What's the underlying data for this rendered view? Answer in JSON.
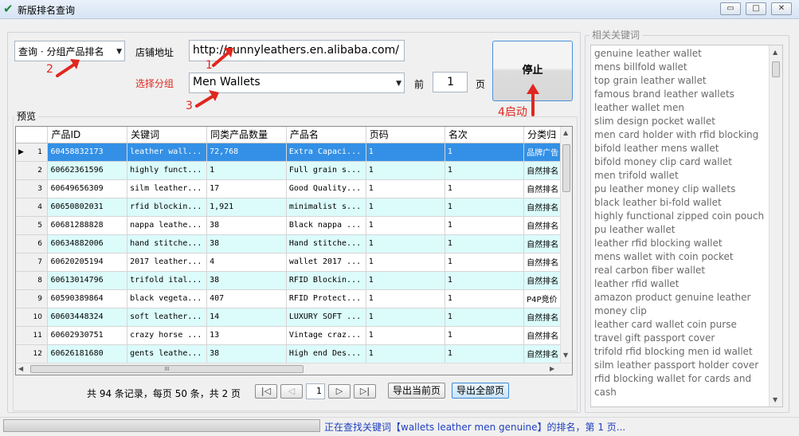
{
  "window": {
    "title": "新版排名查询",
    "minimize": "▭",
    "maximize": "□",
    "close": "✕"
  },
  "query": {
    "mode_select": "查询 · 分组产品排名",
    "shop_label": "店铺地址",
    "shop_url": "http://sunnyleathers.en.alibaba.com/",
    "group_label": "选择分组",
    "group_value": "Men Wallets",
    "top_label": "前",
    "top_value": "1",
    "page_unit": "页",
    "stop_button": "停止"
  },
  "annotations": {
    "a1": "1",
    "a2": "2",
    "a3": "3",
    "a4": "4启动"
  },
  "preview": {
    "title": "预览",
    "columns": [
      "产品ID",
      "关键词",
      "同类产品数量",
      "产品名",
      "页码",
      "名次",
      "分类归"
    ],
    "rows": [
      {
        "i": "1",
        "id": "60458832173",
        "kw": "leather wall...",
        "count": "72,768",
        "name": "Extra Capaci...",
        "page": "1",
        "rank": "1",
        "cat": "品牌广告"
      },
      {
        "i": "2",
        "id": "60662361596",
        "kw": "highly funct...",
        "count": "1",
        "name": "Full grain s...",
        "page": "1",
        "rank": "1",
        "cat": "自然排名"
      },
      {
        "i": "3",
        "id": "60649656309",
        "kw": "silm leather...",
        "count": "17",
        "name": "Good Quality...",
        "page": "1",
        "rank": "1",
        "cat": "自然排名"
      },
      {
        "i": "4",
        "id": "60650802031",
        "kw": "rfid blockin...",
        "count": "1,921",
        "name": "minimalist s...",
        "page": "1",
        "rank": "1",
        "cat": "自然排名"
      },
      {
        "i": "5",
        "id": "60681288828",
        "kw": "nappa leathe...",
        "count": "38",
        "name": "Black nappa ...",
        "page": "1",
        "rank": "1",
        "cat": "自然排名"
      },
      {
        "i": "6",
        "id": "60634882006",
        "kw": "hand stitche...",
        "count": "38",
        "name": "Hand stitche...",
        "page": "1",
        "rank": "1",
        "cat": "自然排名"
      },
      {
        "i": "7",
        "id": "60620205194",
        "kw": "2017 leather...",
        "count": "4",
        "name": "wallet 2017 ...",
        "page": "1",
        "rank": "1",
        "cat": "自然排名"
      },
      {
        "i": "8",
        "id": "60613014796",
        "kw": "trifold ital...",
        "count": "38",
        "name": "RFID Blockin...",
        "page": "1",
        "rank": "1",
        "cat": "自然排名"
      },
      {
        "i": "9",
        "id": "60590389864",
        "kw": "black vegeta...",
        "count": "407",
        "name": "RFID Protect...",
        "page": "1",
        "rank": "1",
        "cat": "P4P竞价"
      },
      {
        "i": "10",
        "id": "60603448324",
        "kw": "soft leather...",
        "count": "14",
        "name": "LUXURY SOFT ...",
        "page": "1",
        "rank": "1",
        "cat": "自然排名"
      },
      {
        "i": "11",
        "id": "60602930751",
        "kw": "crazy horse ...",
        "count": "13",
        "name": "Vintage craz...",
        "page": "1",
        "rank": "1",
        "cat": "自然排名"
      },
      {
        "i": "12",
        "id": "60626181680",
        "kw": "gents leathe...",
        "count": "38",
        "name": "High end Des...",
        "page": "1",
        "rank": "1",
        "cat": "自然排名"
      }
    ],
    "scroll_grip": "III"
  },
  "pager": {
    "summary": "共 94 条记录，每页 50 条，共 2 页",
    "first": "|◁",
    "prev": "◁",
    "page_value": "1",
    "next": "▷",
    "last": "▷|",
    "export_current": "导出当前页",
    "export_all": "导出全部页"
  },
  "keywords": {
    "title": "相关关键词",
    "items": [
      "genuine leather wallet",
      "mens billfold wallet",
      "top grain leather wallet",
      "famous brand leather wallets",
      "leather wallet men",
      "slim design pocket wallet",
      "men card holder with rfid blocking",
      "bifold leather mens wallet",
      "bifold money clip card wallet",
      "men trifold wallet",
      "pu leather money clip wallets",
      "black leather  bi-fold wallet",
      "highly functional zipped coin pouch",
      "pu leather wallet",
      "leather rfid blocking wallet",
      "mens wallet with coin pocket",
      "real carbon fiber wallet",
      "leather rfid wallet",
      "amazon product genuine leather",
      "money clip",
      "leather card wallet coin purse",
      "travel gift passport cover",
      "trifold rfid blocking men id wallet",
      "silm leather passport holder cover",
      "rfid blocking wallet for cards and",
      "cash"
    ]
  },
  "status": {
    "text": "正在查找关键词【wallets leather men genuine】的排名，第 1 页..."
  },
  "colors": {
    "accent_red": "#e0271f",
    "selected_row": "#3390e6",
    "alt_row": "#dcfbfb",
    "status_blue": "#1f3fbf"
  }
}
